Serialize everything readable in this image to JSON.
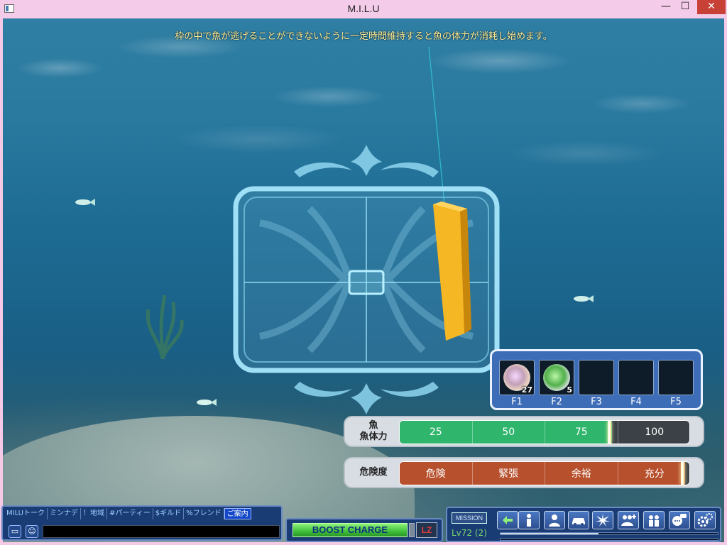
{
  "window": {
    "title": "M.I.L.U",
    "min_label": "—",
    "max_label": "☐",
    "close_label": "✕"
  },
  "instruction": "枠の中で魚が逃げることができないように一定時間維持すると魚の体力が消耗し始めます。",
  "items": [
    {
      "key": "F1",
      "count": "27",
      "type": "pearl-rainbow"
    },
    {
      "key": "F2",
      "count": "5",
      "type": "pearl-green"
    },
    {
      "key": "F3",
      "count": "",
      "type": "empty"
    },
    {
      "key": "F4",
      "count": "",
      "type": "empty"
    },
    {
      "key": "F5",
      "count": "",
      "type": "empty"
    }
  ],
  "fish_stamina": {
    "label_top": "魚",
    "label_bottom": "魚体力",
    "segments": [
      "25",
      "50",
      "75",
      "100"
    ],
    "value_percent": 73,
    "color": "#2fb56c"
  },
  "danger": {
    "label": "危険度",
    "segments": [
      "危険",
      "緊張",
      "余裕",
      "充分"
    ],
    "value_percent": 98,
    "color": "#b7502d"
  },
  "chat": {
    "tabs": [
      "MILUトーク",
      "ミンナデ",
      "！地域",
      "#パーティー",
      "$ギルド",
      "%フレンド",
      "ご案内"
    ],
    "active_tab": 6,
    "input_value": ""
  },
  "boost": {
    "label": "BOOST CHARGE",
    "lz_label": "LZ"
  },
  "hud": {
    "mission_label": "MISSION",
    "level_text": "Lv72 (2)",
    "xp_fraction": 0.45
  }
}
